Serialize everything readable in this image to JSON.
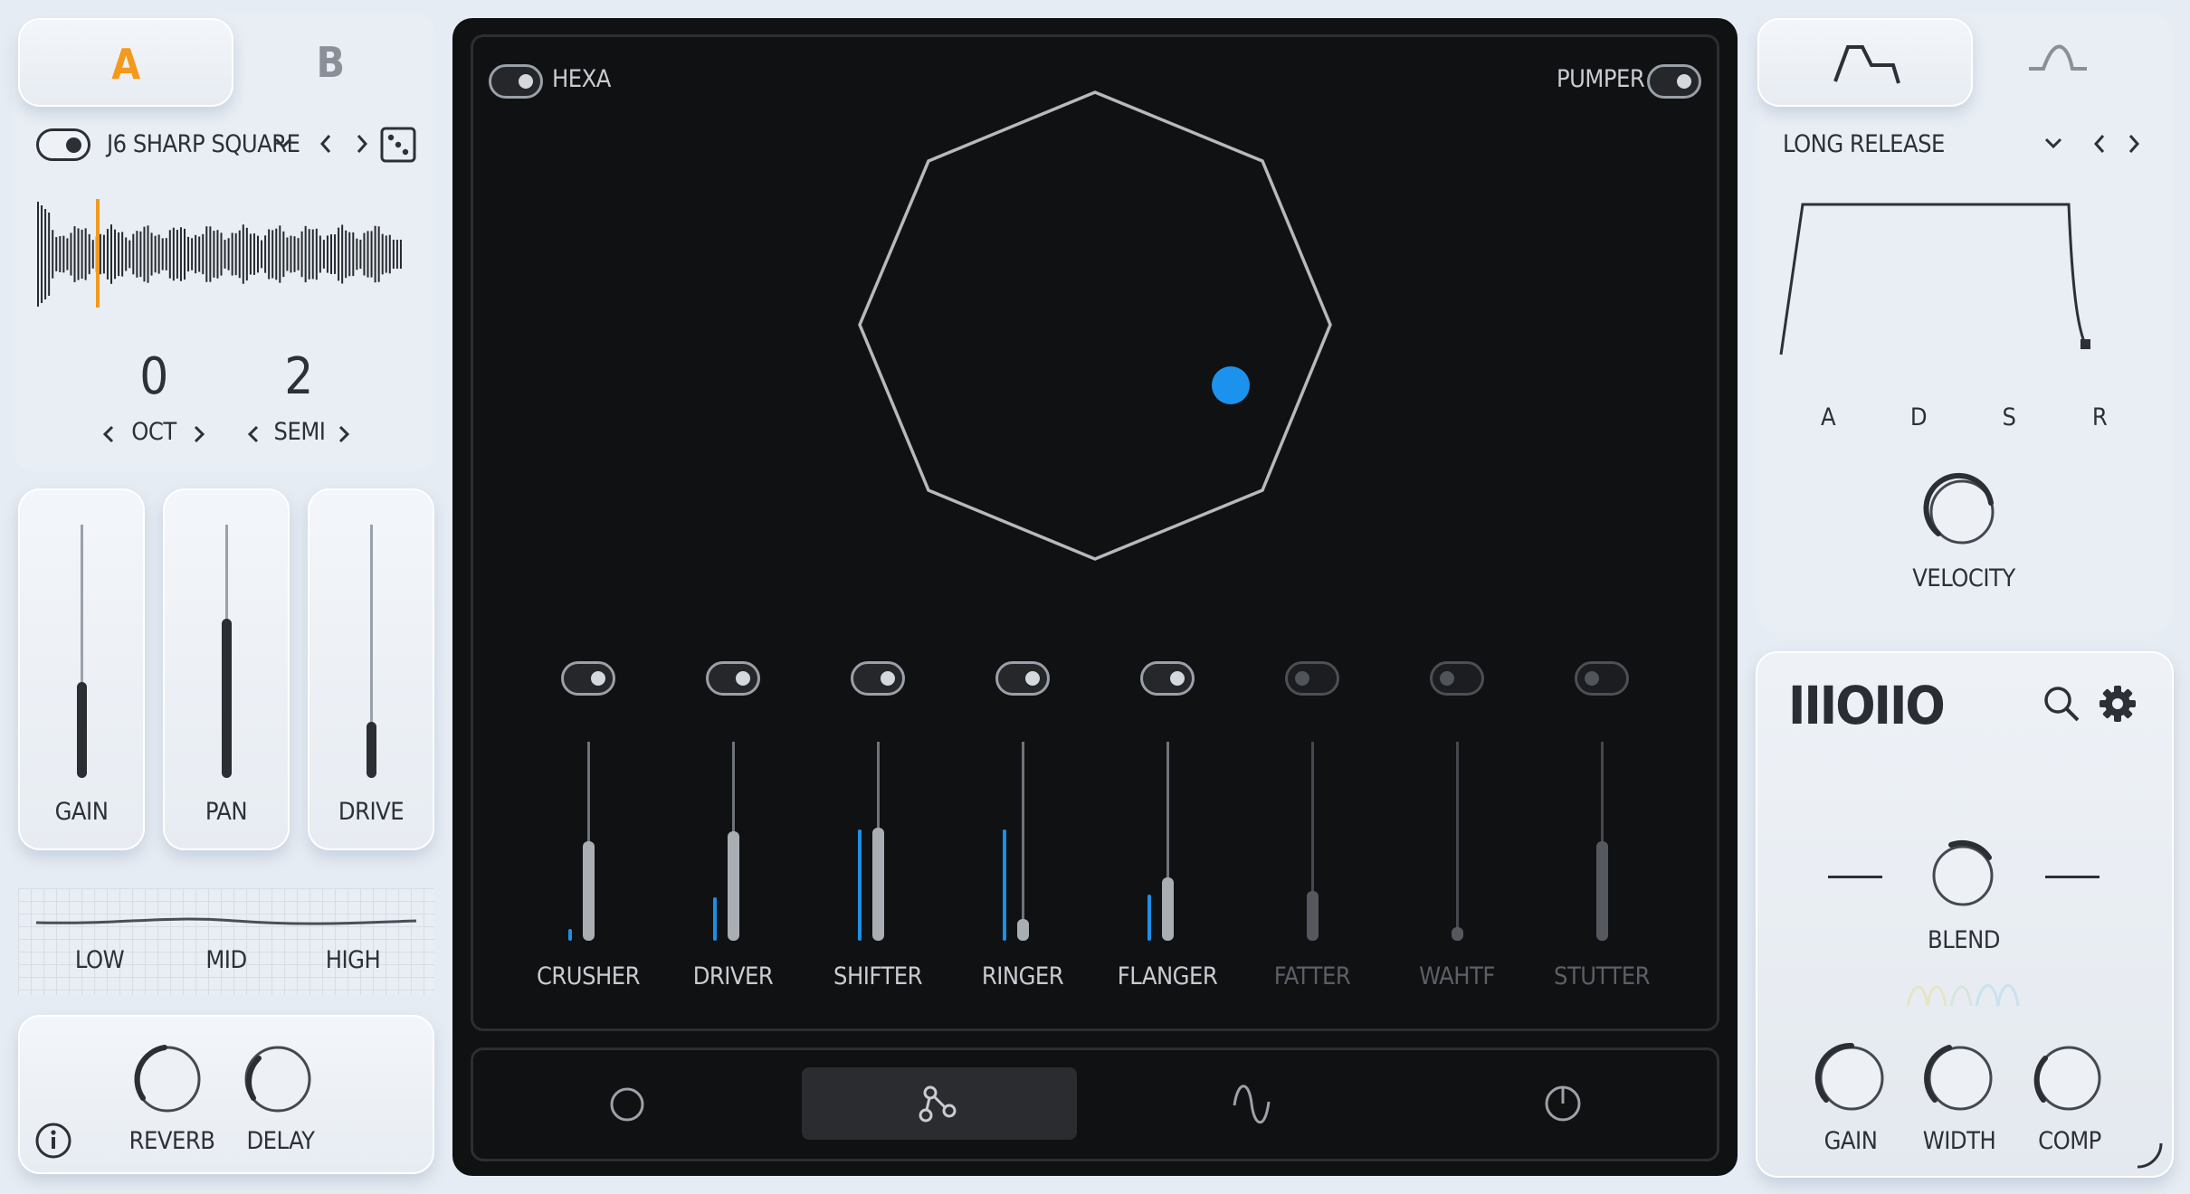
{
  "tabs_left": {
    "a": "A",
    "b": "B"
  },
  "preset": {
    "name": "J6 SHARP SQUARE",
    "prev": "‹",
    "next": "›"
  },
  "pitch": {
    "oct_value": "0",
    "oct_label": "OCT",
    "semi_value": "2",
    "semi_label": "SEMI"
  },
  "faders_left": [
    {
      "label": "GAIN",
      "level": 0.38
    },
    {
      "label": "PAN",
      "level": 0.63
    },
    {
      "label": "DRIVE",
      "level": 0.22
    }
  ],
  "eq": {
    "low": "LOW",
    "mid": "MID",
    "high": "HIGH"
  },
  "fx_left": {
    "reverb": "REVERB",
    "delay": "DELAY"
  },
  "center": {
    "hexa": "HEXA",
    "pumper": "PUMPER"
  },
  "effects": [
    {
      "label": "CRUSHER",
      "on": true,
      "level": 0.5,
      "mod": 0.06
    },
    {
      "label": "DRIVER",
      "on": true,
      "level": 0.55,
      "mod": 0.22
    },
    {
      "label": "SHIFTER",
      "on": true,
      "level": 0.57,
      "mod": 0.56
    },
    {
      "label": "RINGER",
      "on": true,
      "level": 0.11,
      "mod": 0.56
    },
    {
      "label": "FLANGER",
      "on": true,
      "level": 0.32,
      "mod": 0.23
    },
    {
      "label": "FATTER",
      "on": false,
      "level": 0.25,
      "mod": 0
    },
    {
      "label": "WAHTF",
      "on": false,
      "level": 0.07,
      "mod": 0
    },
    {
      "label": "STUTTER",
      "on": false,
      "level": 0.5,
      "mod": 0
    }
  ],
  "envelope": {
    "preset": "LONG RELEASE",
    "a": "A",
    "d": "D",
    "s": "S",
    "r": "R",
    "velocity": "VELOCITY"
  },
  "brand": {
    "logo": "IIIOIIO"
  },
  "output": {
    "blend": "BLEND",
    "gain": "GAIN",
    "width": "WIDTH",
    "comp": "COMP"
  },
  "colors": {
    "accent_orange": "#f39a1e",
    "accent_blue": "#1b93ee",
    "dark_panel": "#101112"
  }
}
